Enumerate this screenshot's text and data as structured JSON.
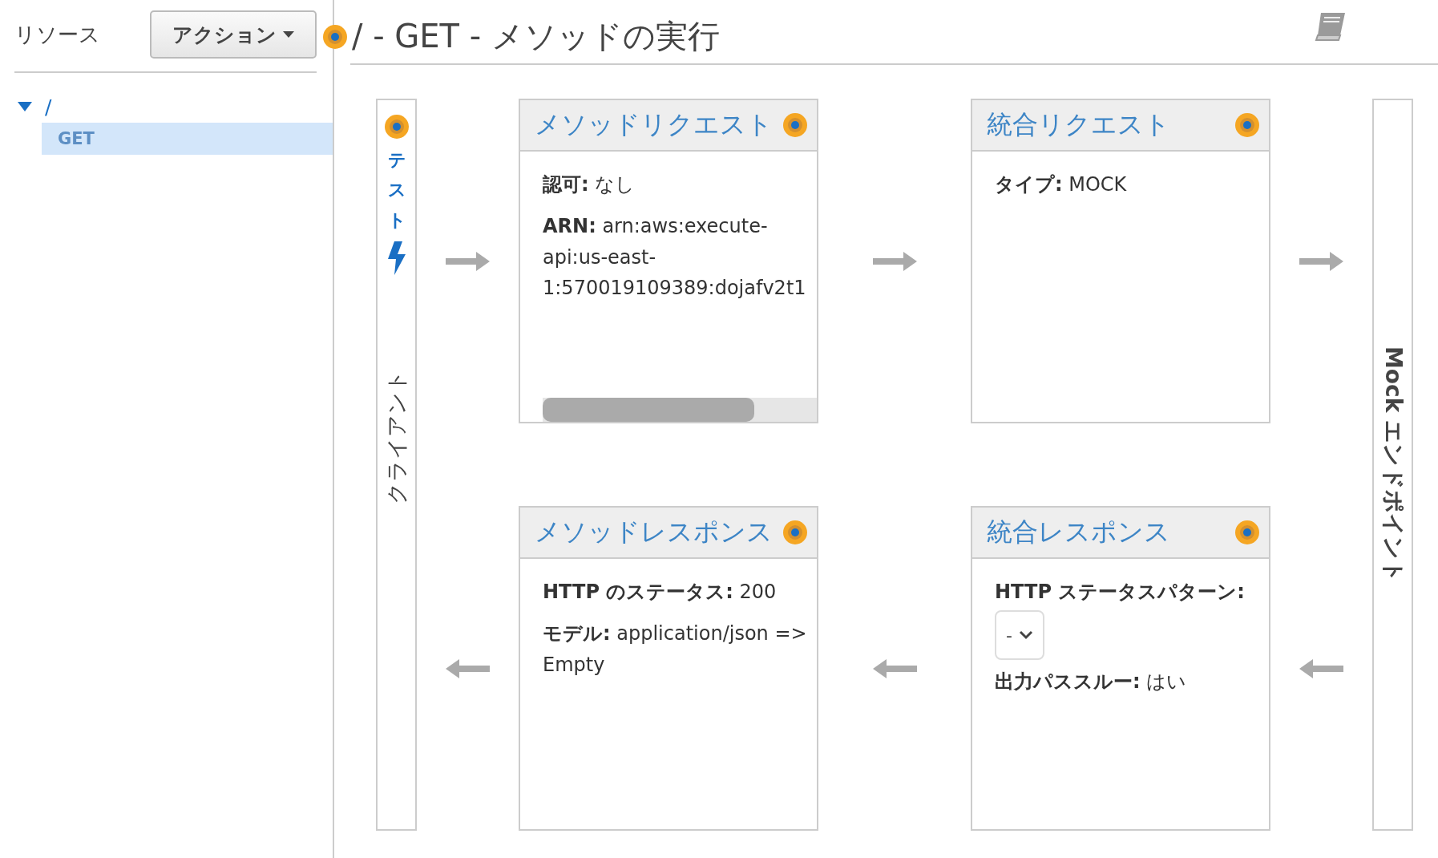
{
  "sidebar": {
    "title": "リソース",
    "action_button": "アクション",
    "tree": [
      {
        "label": "/",
        "expanded": true,
        "selected": false,
        "children": [
          {
            "label": "GET",
            "selected": true
          }
        ]
      }
    ]
  },
  "page": {
    "title": "/ - GET - メソッドの実行"
  },
  "client": {
    "test_label": "テスト",
    "label": "クライアント"
  },
  "endpoint": {
    "label": "Mock エンドポイント"
  },
  "stages": [
    {
      "title": "メソッドリクエスト",
      "scrollable": true,
      "fields": [
        {
          "kind": "text",
          "label": "認可:",
          "value": "なし"
        },
        {
          "kind": "text",
          "label": "ARN:",
          "value": "arn:aws:execute-api:us-east-1:570019109389:dojafv2t1"
        }
      ]
    },
    {
      "title": "統合リクエスト",
      "fields": [
        {
          "kind": "text",
          "label": "タイプ:",
          "value": "MOCK"
        }
      ]
    },
    {
      "title": "メソッドレスポンス",
      "fields": [
        {
          "kind": "text",
          "label": "HTTP のステータス:",
          "value": "200"
        },
        {
          "kind": "text",
          "label": "モデル:",
          "value": "application/json => Empty"
        }
      ]
    },
    {
      "title": "統合レスポンス",
      "fields": [
        {
          "kind": "select",
          "label": "HTTP ステータスパターン:",
          "value": "-"
        },
        {
          "kind": "text",
          "label": "出力パススルー:",
          "value": "はい"
        }
      ]
    }
  ]
}
